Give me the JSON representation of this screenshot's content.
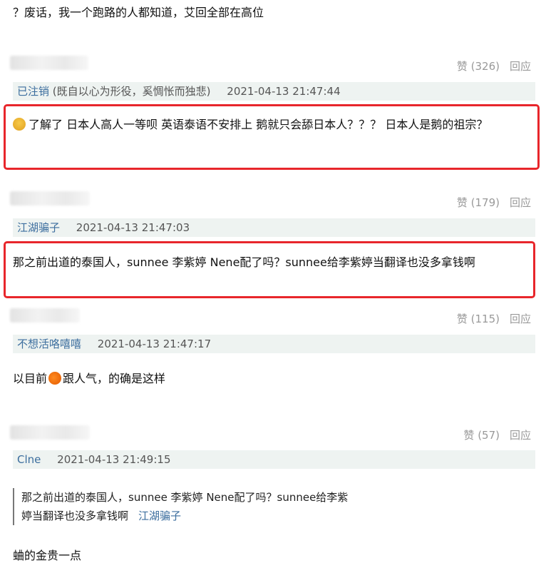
{
  "top_line": "？废话，我一个跑路的人都知道，艾回全部在高位",
  "comments": [
    {
      "likes": "赞 (326)",
      "reply": "回应",
      "user": "已注销",
      "signature": "(既自以心为形役，奚惆怅而独悲)",
      "time": "2021-04-13 21:47:44",
      "content": "了解了 日本人高人一等呗 英语泰语不安排上 鹅就只会舔日本人？？？ 日本人是鹅的祖宗？",
      "emoji": "dizzy-face-icon"
    },
    {
      "likes": "赞 (179)",
      "reply": "回应",
      "user": "江湖骗子",
      "time": "2021-04-13 21:47:03",
      "content": "那之前出道的泰国人，sunnee 李紫婷 Nene配了吗？sunnee给李紫婷当翻译也没多拿钱啊"
    },
    {
      "likes": "赞 (115)",
      "reply": "回应",
      "user": "不想活咯嘻嘻",
      "time": "2021-04-13 21:47:17",
      "content_before": "以目前",
      "content_after": "跟人气，的确是这样",
      "emoji": "orange-icon"
    },
    {
      "likes": "赞 (57)",
      "reply": "回应",
      "user": "Clne",
      "time": "2021-04-13 21:49:15",
      "quote_line1": "那之前出道的泰国人，sunnee 李紫婷 Nene配了吗？sunnee给李紫",
      "quote_line2": "婷当翻译也没多拿钱啊",
      "quote_user": "江湖骗子",
      "content": "蛐的金贵一点"
    }
  ],
  "colors": {
    "highlight_border": "#e8262b",
    "link": "#3c6e9e",
    "meta_bg": "#eef3f1",
    "muted": "#999999"
  }
}
